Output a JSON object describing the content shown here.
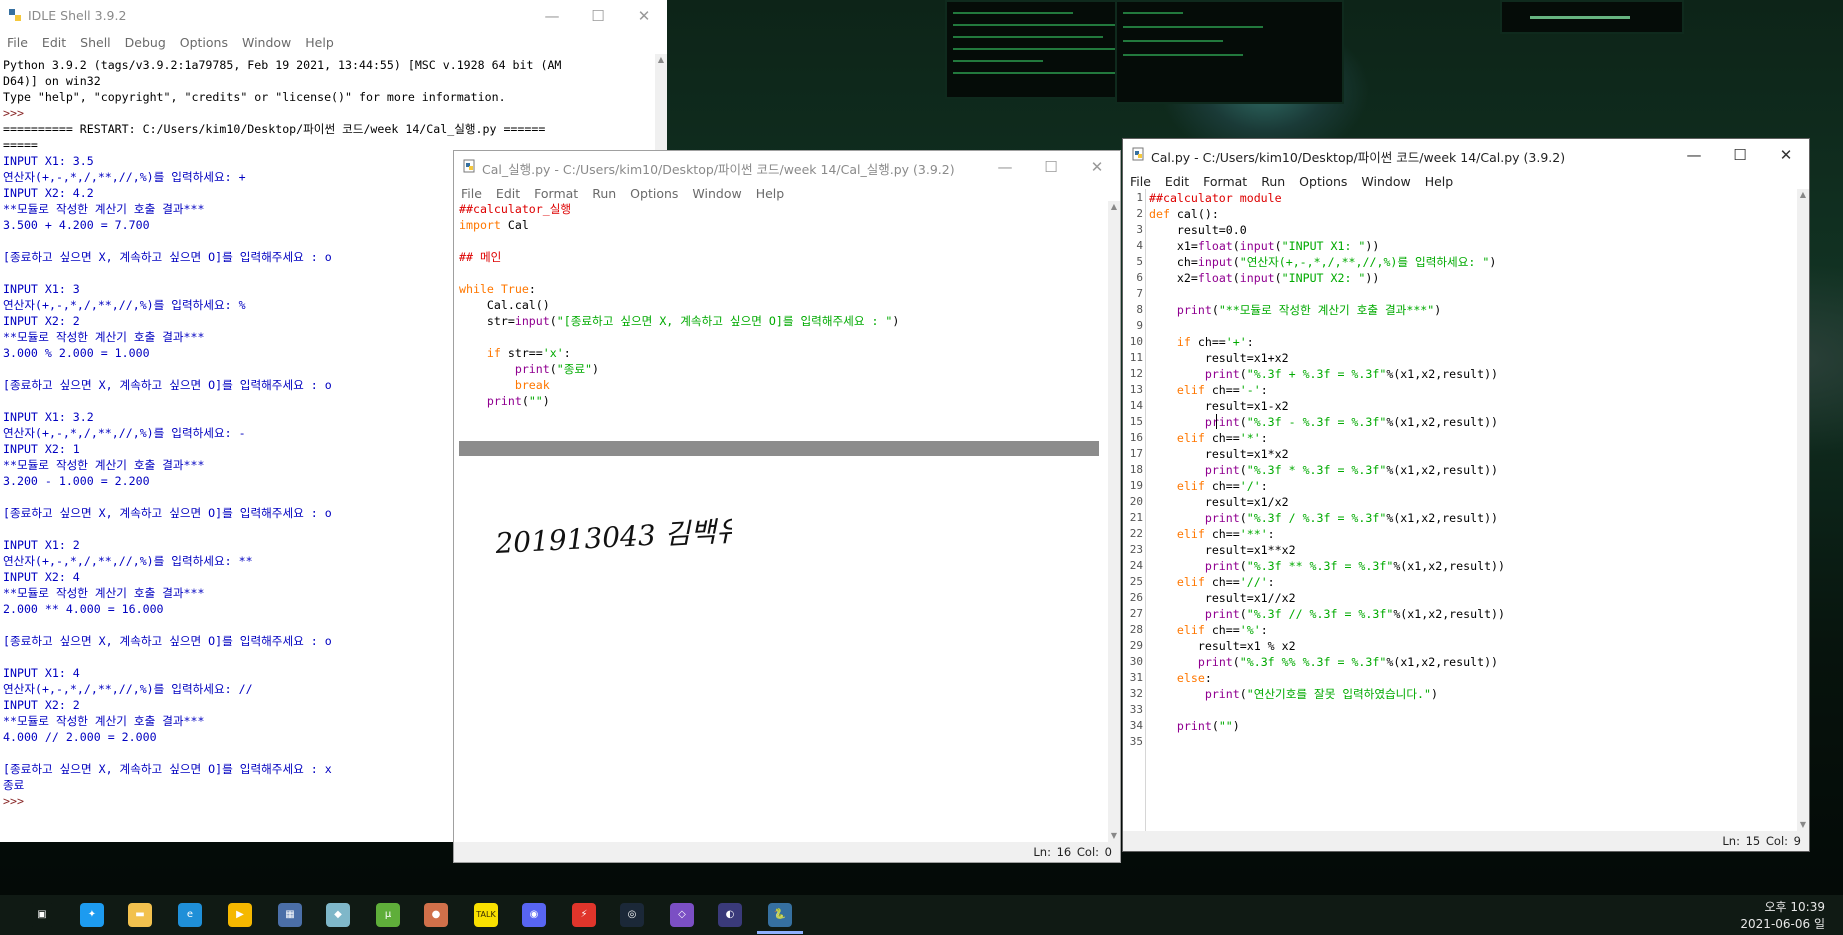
{
  "shell": {
    "title": "IDLE Shell 3.9.2",
    "menu": [
      "File",
      "Edit",
      "Shell",
      "Debug",
      "Options",
      "Window",
      "Help"
    ],
    "lines": [
      {
        "t": "Python 3.9.2 (tags/v3.9.2:1a79785, Feb 19 2021, 13:44:55) [MSC v.1928 64 bit (AM",
        "c": ""
      },
      {
        "t": "D64)] on win32",
        "c": ""
      },
      {
        "t": "Type \"help\", \"copyright\", \"credits\" or \"license()\" for more information.",
        "c": ""
      },
      {
        "t": ">>> ",
        "c": "prompt"
      },
      {
        "t": "========== RESTART: C:/Users/kim10/Desktop/파이썬 코드/week 14/Cal_실행.py ======",
        "c": ""
      },
      {
        "t": "=====",
        "c": ""
      },
      {
        "t": "INPUT X1: 3.5",
        "c": "out"
      },
      {
        "t": "연산자(+,-,*,/,**,//,%)를 입력하세요: +",
        "c": "out"
      },
      {
        "t": "INPUT X2: 4.2",
        "c": "out"
      },
      {
        "t": "**모듈로 작성한 계산기 호출 결과***",
        "c": "out"
      },
      {
        "t": "3.500 + 4.200 = 7.700",
        "c": "out"
      },
      {
        "t": "",
        "c": ""
      },
      {
        "t": "[종료하고 싶으면 X, 계속하고 싶으면 O]를 입력해주세요 : o",
        "c": "out"
      },
      {
        "t": "",
        "c": ""
      },
      {
        "t": "INPUT X1: 3",
        "c": "out"
      },
      {
        "t": "연산자(+,-,*,/,**,//,%)를 입력하세요: %",
        "c": "out"
      },
      {
        "t": "INPUT X2: 2",
        "c": "out"
      },
      {
        "t": "**모듈로 작성한 계산기 호출 결과***",
        "c": "out"
      },
      {
        "t": "3.000 % 2.000 = 1.000",
        "c": "out"
      },
      {
        "t": "",
        "c": ""
      },
      {
        "t": "[종료하고 싶으면 X, 계속하고 싶으면 O]를 입력해주세요 : o",
        "c": "out"
      },
      {
        "t": "",
        "c": ""
      },
      {
        "t": "INPUT X1: 3.2",
        "c": "out"
      },
      {
        "t": "연산자(+,-,*,/,**,//,%)를 입력하세요: -",
        "c": "out"
      },
      {
        "t": "INPUT X2: 1",
        "c": "out"
      },
      {
        "t": "**모듈로 작성한 계산기 호출 결과***",
        "c": "out"
      },
      {
        "t": "3.200 - 1.000 = 2.200",
        "c": "out"
      },
      {
        "t": "",
        "c": ""
      },
      {
        "t": "[종료하고 싶으면 X, 계속하고 싶으면 O]를 입력해주세요 : o",
        "c": "out"
      },
      {
        "t": "",
        "c": ""
      },
      {
        "t": "INPUT X1: 2",
        "c": "out"
      },
      {
        "t": "연산자(+,-,*,/,**,//,%)를 입력하세요: **",
        "c": "out"
      },
      {
        "t": "INPUT X2: 4",
        "c": "out"
      },
      {
        "t": "**모듈로 작성한 계산기 호출 결과***",
        "c": "out"
      },
      {
        "t": "2.000 ** 4.000 = 16.000",
        "c": "out"
      },
      {
        "t": "",
        "c": ""
      },
      {
        "t": "[종료하고 싶으면 X, 계속하고 싶으면 O]를 입력해주세요 : o",
        "c": "out"
      },
      {
        "t": "",
        "c": ""
      },
      {
        "t": "INPUT X1: 4",
        "c": "out"
      },
      {
        "t": "연산자(+,-,*,/,**,//,%)를 입력하세요: //",
        "c": "out"
      },
      {
        "t": "INPUT X2: 2",
        "c": "out"
      },
      {
        "t": "**모듈로 작성한 계산기 호출 결과***",
        "c": "out"
      },
      {
        "t": "4.000 // 2.000 = 2.000",
        "c": "out"
      },
      {
        "t": "",
        "c": ""
      },
      {
        "t": "[종료하고 싶으면 X, 계속하고 싶으면 O]를 입력해주세요 : x",
        "c": "out"
      },
      {
        "t": "종료",
        "c": "out"
      },
      {
        "t": ">>> ",
        "c": "prompt"
      }
    ]
  },
  "runner": {
    "title": "Cal_실행.py - C:/Users/kim10/Desktop/파이썬 코드/week 14/Cal_실행.py (3.9.2)",
    "menu": [
      "File",
      "Edit",
      "Format",
      "Run",
      "Options",
      "Window",
      "Help"
    ],
    "status": "Ln: 16   Col: 0",
    "handwriting": "201913043 김백유",
    "lines": [
      [
        {
          "t": "##calculator_실행",
          "c": "cm"
        }
      ],
      [
        {
          "t": "import",
          "c": "kw"
        },
        {
          "t": " Cal",
          "c": ""
        }
      ],
      [
        {
          "t": "",
          "c": ""
        }
      ],
      [
        {
          "t": "## 메인",
          "c": "cm"
        }
      ],
      [
        {
          "t": "",
          "c": ""
        }
      ],
      [
        {
          "t": "while",
          "c": "kw"
        },
        {
          "t": " ",
          "c": ""
        },
        {
          "t": "True",
          "c": "kw"
        },
        {
          "t": ":",
          "c": ""
        }
      ],
      [
        {
          "t": "    Cal.cal()",
          "c": ""
        }
      ],
      [
        {
          "t": "    str=",
          "c": ""
        },
        {
          "t": "input",
          "c": "bi"
        },
        {
          "t": "(",
          "c": ""
        },
        {
          "t": "\"[종료하고 싶으면 X, 계속하고 싶으면 O]를 입력해주세요 : \"",
          "c": "str"
        },
        {
          "t": ")",
          "c": ""
        }
      ],
      [
        {
          "t": "",
          "c": ""
        }
      ],
      [
        {
          "t": "    ",
          "c": ""
        },
        {
          "t": "if",
          "c": "kw"
        },
        {
          "t": " str==",
          "c": ""
        },
        {
          "t": "'x'",
          "c": "str"
        },
        {
          "t": ":",
          "c": ""
        }
      ],
      [
        {
          "t": "        ",
          "c": ""
        },
        {
          "t": "print",
          "c": "bi"
        },
        {
          "t": "(",
          "c": ""
        },
        {
          "t": "\"종료\"",
          "c": "str"
        },
        {
          "t": ")",
          "c": ""
        }
      ],
      [
        {
          "t": "        ",
          "c": ""
        },
        {
          "t": "break",
          "c": "kw"
        }
      ],
      [
        {
          "t": "    ",
          "c": ""
        },
        {
          "t": "print",
          "c": "bi"
        },
        {
          "t": "(",
          "c": ""
        },
        {
          "t": "\"\"",
          "c": "str"
        },
        {
          "t": ")",
          "c": ""
        }
      ]
    ]
  },
  "calpy": {
    "title": "Cal.py - C:/Users/kim10/Desktop/파이썬 코드/week 14/Cal.py (3.9.2)",
    "menu": [
      "File",
      "Edit",
      "Format",
      "Run",
      "Options",
      "Window",
      "Help"
    ],
    "status": "Ln: 15   Col: 9",
    "lines": [
      [
        {
          "t": "##calculator module",
          "c": "cm"
        }
      ],
      [
        {
          "t": "def",
          "c": "kw"
        },
        {
          "t": " cal():",
          "c": ""
        }
      ],
      [
        {
          "t": "    result=0.0",
          "c": ""
        }
      ],
      [
        {
          "t": "    x1=",
          "c": ""
        },
        {
          "t": "float",
          "c": "bi"
        },
        {
          "t": "(",
          "c": ""
        },
        {
          "t": "input",
          "c": "bi"
        },
        {
          "t": "(",
          "c": ""
        },
        {
          "t": "\"INPUT X1: \"",
          "c": "str"
        },
        {
          "t": "))",
          "c": ""
        }
      ],
      [
        {
          "t": "    ch=",
          "c": ""
        },
        {
          "t": "input",
          "c": "bi"
        },
        {
          "t": "(",
          "c": ""
        },
        {
          "t": "\"연산자(+,-,*,/,**,//,%)를 입력하세요: \"",
          "c": "str"
        },
        {
          "t": ")",
          "c": ""
        }
      ],
      [
        {
          "t": "    x2=",
          "c": ""
        },
        {
          "t": "float",
          "c": "bi"
        },
        {
          "t": "(",
          "c": ""
        },
        {
          "t": "input",
          "c": "bi"
        },
        {
          "t": "(",
          "c": ""
        },
        {
          "t": "\"INPUT X2: \"",
          "c": "str"
        },
        {
          "t": "))",
          "c": ""
        }
      ],
      [
        {
          "t": "",
          "c": ""
        }
      ],
      [
        {
          "t": "    ",
          "c": ""
        },
        {
          "t": "print",
          "c": "bi"
        },
        {
          "t": "(",
          "c": ""
        },
        {
          "t": "\"**모듈로 작성한 계산기 호출 결과***\"",
          "c": "str"
        },
        {
          "t": ")",
          "c": ""
        }
      ],
      [
        {
          "t": "",
          "c": ""
        }
      ],
      [
        {
          "t": "    ",
          "c": ""
        },
        {
          "t": "if",
          "c": "kw"
        },
        {
          "t": " ch==",
          "c": ""
        },
        {
          "t": "'+'",
          "c": "str"
        },
        {
          "t": ":",
          "c": ""
        }
      ],
      [
        {
          "t": "        result=x1+x2",
          "c": ""
        }
      ],
      [
        {
          "t": "        ",
          "c": ""
        },
        {
          "t": "print",
          "c": "bi"
        },
        {
          "t": "(",
          "c": ""
        },
        {
          "t": "\"%.3f + %.3f = %.3f\"",
          "c": "str"
        },
        {
          "t": "%(x1,x2,result))",
          "c": ""
        }
      ],
      [
        {
          "t": "    ",
          "c": ""
        },
        {
          "t": "elif",
          "c": "kw"
        },
        {
          "t": " ch==",
          "c": ""
        },
        {
          "t": "'-'",
          "c": "str"
        },
        {
          "t": ":",
          "c": ""
        }
      ],
      [
        {
          "t": "        result=x1-x2",
          "c": ""
        }
      ],
      [
        {
          "t": "        ",
          "c": ""
        },
        {
          "t": "print",
          "c": "bi"
        },
        {
          "t": "(",
          "c": ""
        },
        {
          "t": "\"%.3f - %.3f = %.3f\"",
          "c": "str"
        },
        {
          "t": "%(x1,x2,result))",
          "c": ""
        }
      ],
      [
        {
          "t": "    ",
          "c": ""
        },
        {
          "t": "elif",
          "c": "kw"
        },
        {
          "t": " ch==",
          "c": ""
        },
        {
          "t": "'*'",
          "c": "str"
        },
        {
          "t": ":",
          "c": ""
        }
      ],
      [
        {
          "t": "        result=x1*x2",
          "c": ""
        }
      ],
      [
        {
          "t": "        ",
          "c": ""
        },
        {
          "t": "print",
          "c": "bi"
        },
        {
          "t": "(",
          "c": ""
        },
        {
          "t": "\"%.3f * %.3f = %.3f\"",
          "c": "str"
        },
        {
          "t": "%(x1,x2,result))",
          "c": ""
        }
      ],
      [
        {
          "t": "    ",
          "c": ""
        },
        {
          "t": "elif",
          "c": "kw"
        },
        {
          "t": " ch==",
          "c": ""
        },
        {
          "t": "'/'",
          "c": "str"
        },
        {
          "t": ":",
          "c": ""
        }
      ],
      [
        {
          "t": "        result=x1/x2",
          "c": ""
        }
      ],
      [
        {
          "t": "        ",
          "c": ""
        },
        {
          "t": "print",
          "c": "bi"
        },
        {
          "t": "(",
          "c": ""
        },
        {
          "t": "\"%.3f / %.3f = %.3f\"",
          "c": "str"
        },
        {
          "t": "%(x1,x2,result))",
          "c": ""
        }
      ],
      [
        {
          "t": "    ",
          "c": ""
        },
        {
          "t": "elif",
          "c": "kw"
        },
        {
          "t": " ch==",
          "c": ""
        },
        {
          "t": "'**'",
          "c": "str"
        },
        {
          "t": ":",
          "c": ""
        }
      ],
      [
        {
          "t": "        result=x1**x2",
          "c": ""
        }
      ],
      [
        {
          "t": "        ",
          "c": ""
        },
        {
          "t": "print",
          "c": "bi"
        },
        {
          "t": "(",
          "c": ""
        },
        {
          "t": "\"%.3f ** %.3f = %.3f\"",
          "c": "str"
        },
        {
          "t": "%(x1,x2,result))",
          "c": ""
        }
      ],
      [
        {
          "t": "    ",
          "c": ""
        },
        {
          "t": "elif",
          "c": "kw"
        },
        {
          "t": " ch==",
          "c": ""
        },
        {
          "t": "'//'",
          "c": "str"
        },
        {
          "t": ":",
          "c": ""
        }
      ],
      [
        {
          "t": "        result=x1//x2",
          "c": ""
        }
      ],
      [
        {
          "t": "        ",
          "c": ""
        },
        {
          "t": "print",
          "c": "bi"
        },
        {
          "t": "(",
          "c": ""
        },
        {
          "t": "\"%.3f // %.3f = %.3f\"",
          "c": "str"
        },
        {
          "t": "%(x1,x2,result))",
          "c": ""
        }
      ],
      [
        {
          "t": "    ",
          "c": ""
        },
        {
          "t": "elif",
          "c": "kw"
        },
        {
          "t": " ch==",
          "c": ""
        },
        {
          "t": "'%'",
          "c": "str"
        },
        {
          "t": ":",
          "c": ""
        }
      ],
      [
        {
          "t": "       result=x1 % x2",
          "c": ""
        }
      ],
      [
        {
          "t": "       ",
          "c": ""
        },
        {
          "t": "print",
          "c": "bi"
        },
        {
          "t": "(",
          "c": ""
        },
        {
          "t": "\"%.3f %% %.3f = %.3f\"",
          "c": "str"
        },
        {
          "t": "%(x1,x2,result))",
          "c": ""
        }
      ],
      [
        {
          "t": "    ",
          "c": ""
        },
        {
          "t": "else",
          "c": "kw"
        },
        {
          "t": ":",
          "c": ""
        }
      ],
      [
        {
          "t": "        ",
          "c": ""
        },
        {
          "t": "print",
          "c": "bi"
        },
        {
          "t": "(",
          "c": ""
        },
        {
          "t": "\"연산기호를 잘못 입력하였습니다.\"",
          "c": "str"
        },
        {
          "t": ")",
          "c": ""
        }
      ],
      [
        {
          "t": "",
          "c": ""
        }
      ],
      [
        {
          "t": "    ",
          "c": ""
        },
        {
          "t": "print",
          "c": "bi"
        },
        {
          "t": "(",
          "c": ""
        },
        {
          "t": "\"\"",
          "c": "str"
        },
        {
          "t": ")",
          "c": ""
        }
      ],
      [
        {
          "t": "",
          "c": ""
        }
      ]
    ]
  },
  "taskbar": {
    "icons": [
      {
        "name": "task-view-icon",
        "color": "#101a14",
        "glyph": "▣"
      },
      {
        "name": "bird-app-icon",
        "color": "#1d9bf0",
        "glyph": "✦"
      },
      {
        "name": "file-explorer-icon",
        "color": "#f2c14e",
        "glyph": "▬"
      },
      {
        "name": "edge-icon",
        "color": "#1f8fd8",
        "glyph": "e"
      },
      {
        "name": "media-player-icon",
        "color": "#f5b800",
        "glyph": "▶"
      },
      {
        "name": "calculator-icon",
        "color": "#4b6fa8",
        "glyph": "▦"
      },
      {
        "name": "app-icon",
        "color": "#7fb7c9",
        "glyph": "◆"
      },
      {
        "name": "utorrent-icon",
        "color": "#5fae3a",
        "glyph": "µ"
      },
      {
        "name": "paint-app-icon",
        "color": "#d0704a",
        "glyph": "●"
      },
      {
        "name": "kakaotalk-icon",
        "color": "#f9e000",
        "glyph": "TALK"
      },
      {
        "name": "discord-icon",
        "color": "#5865f2",
        "glyph": "◉"
      },
      {
        "name": "flash-app-icon",
        "color": "#e0352b",
        "glyph": "⚡"
      },
      {
        "name": "steam-icon",
        "color": "#1b2838",
        "glyph": "◎"
      },
      {
        "name": "visual-studio-icon",
        "color": "#7b4fc4",
        "glyph": "◇"
      },
      {
        "name": "eclipse-icon",
        "color": "#3a3a7a",
        "glyph": "◐"
      },
      {
        "name": "idle-python-icon",
        "color": "#3670a0",
        "glyph": "🐍"
      }
    ],
    "clock_time": "오후 10:39",
    "clock_date": "2021-06-06 일"
  }
}
